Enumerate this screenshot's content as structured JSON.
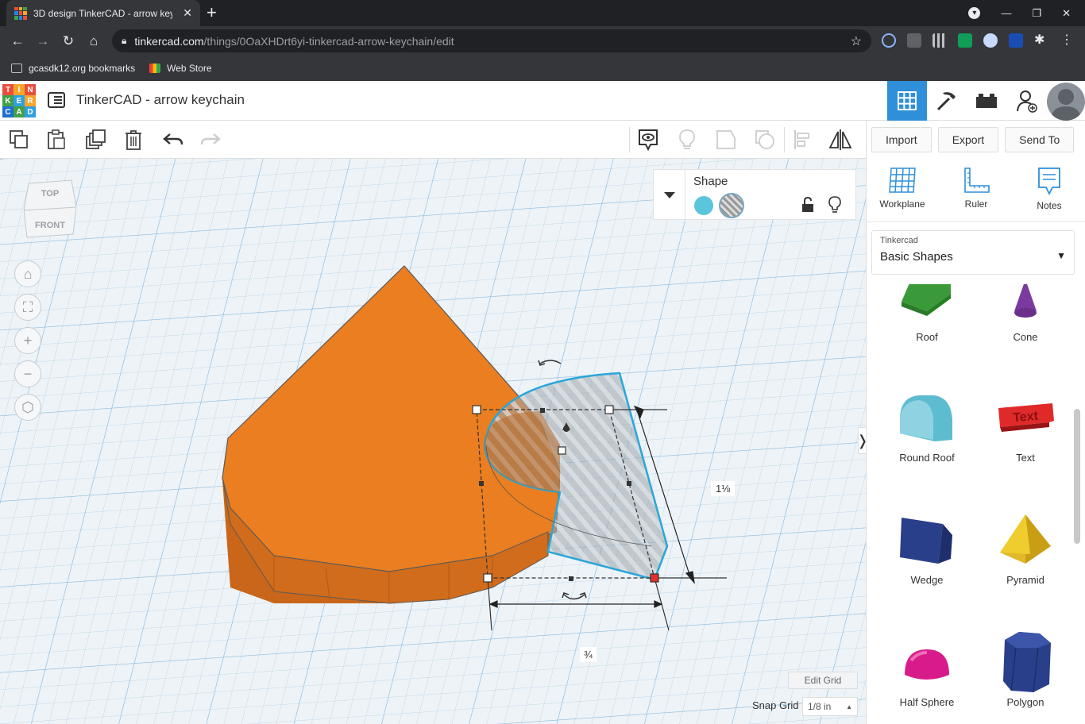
{
  "browser": {
    "tab_title": "3D design TinkerCAD - arrow keychain | Tinkercad",
    "url_host": "tinkercad.com",
    "url_path": "/things/0OaXHDrt6yi-tinkercad-arrow-keychain/edit",
    "bookmarks": [
      "gcasdk12.org bookmarks",
      "Web Store"
    ]
  },
  "app": {
    "logo_letters": [
      "T",
      "I",
      "N",
      "K",
      "E",
      "R",
      "C",
      "A",
      "D"
    ],
    "design_title": "TinkerCAD - arrow keychain",
    "accent_color": "#2f8fd8"
  },
  "right_panel": {
    "import_label": "Import",
    "export_label": "Export",
    "sendto_label": "Send To",
    "tools": [
      "Workplane",
      "Ruler",
      "Notes"
    ],
    "library_category": "Tinkercad",
    "library_name": "Basic Shapes",
    "shapes": [
      "Roof",
      "Cone",
      "Round Roof",
      "Text",
      "Wedge",
      "Pyramid",
      "Half Sphere",
      "Polygon"
    ]
  },
  "inspector": {
    "title": "Shape",
    "solid_color": "#5bc5dc"
  },
  "workspace": {
    "viewcube_top": "TOP",
    "viewcube_front": "FRONT",
    "dim_height": "1⅛",
    "dim_width": "¾",
    "edit_grid_label": "Edit Grid",
    "snap_grid_label": "Snap Grid",
    "snap_grid_value": "1/8 in",
    "shape_color": "#ea7e20"
  }
}
